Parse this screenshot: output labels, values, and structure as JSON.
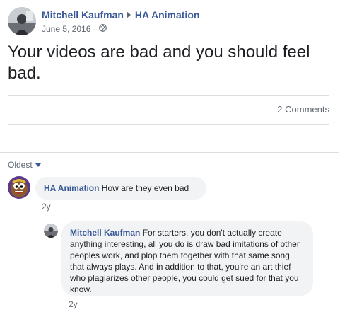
{
  "post": {
    "author": "Mitchell Kaufman",
    "target": "HA Animation",
    "date": "June 5, 2016",
    "separator": "·",
    "privacy_icon": "globe-icon",
    "text": "Your videos are bad and you should feel bad.",
    "comment_count": "2 Comments"
  },
  "comments": {
    "sort_label": "Oldest",
    "items": [
      {
        "author": "HA Animation",
        "text": "How are they even bad",
        "time": "2y"
      },
      {
        "author": "Mitchell Kaufman",
        "text": "For starters, you don't actually create anything interesting, all you do is draw bad imitations of other peoples work, and plop them together with that same song that always plays. And in addition to that, you're an art thief who plagiarizes other people, you could get sued for that you know.",
        "time": "2y"
      }
    ]
  },
  "colors": {
    "link": "#385898",
    "meta": "#606770",
    "bubble": "#f2f3f5",
    "divider": "#dadde1"
  }
}
